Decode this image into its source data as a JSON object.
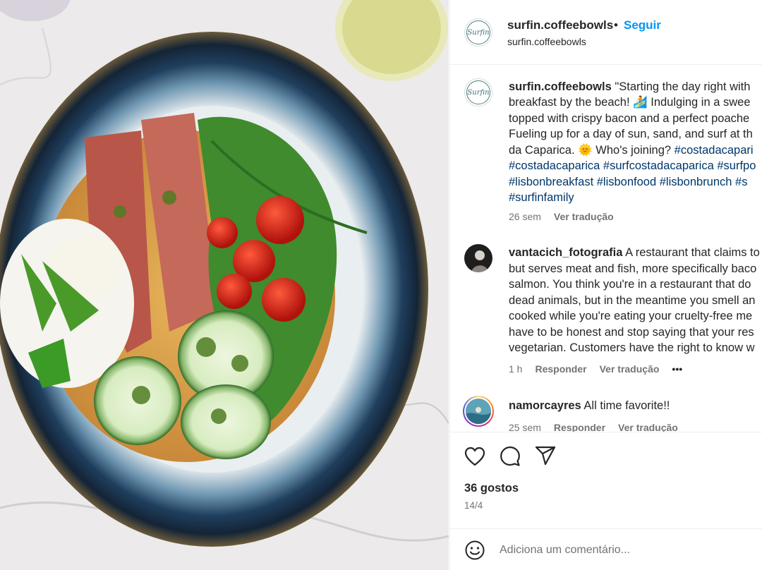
{
  "post": {
    "username": "surfin.coffeebowls",
    "follow_label": "Seguir",
    "location": "surfin.coffeebowls",
    "dot": "•",
    "avatar_text": "Surfin",
    "photo_alt": "Waffle with bacon, poached egg, cherry tomatoes, cucumber and arugula on a blue ceramic plate"
  },
  "caption": {
    "username": "surfin.coffeebowls",
    "lines": [
      "\"Starting the day right with",
      "breakfast by the beach! 🏄 Indulging in a swee",
      "topped with crispy bacon and a perfect poache",
      "Fueling up for a day of sun, sand, and surf at th",
      "da Caparica. 🌞 Who's joining?"
    ],
    "tag_inline": "#costadacapari",
    "tag_lines": [
      "#costadacaparica #surfcostadacaparica #surfpo",
      "#lisbonbreakfast #lisbonfood #lisbonbrunch #s",
      "#surfinfamily"
    ],
    "time": "26 sem",
    "translate": "Ver tradução"
  },
  "comments": [
    {
      "username": "vantacich_fotografia",
      "lines": [
        "A restaurant that claims to",
        "but serves meat and fish, more specifically baco",
        "salmon. You think you're in a restaurant that do",
        "dead animals, but in the meantime you smell an",
        "cooked while you're eating your cruelty-free me",
        "have to be honest and stop saying that your res",
        "vegetarian. Customers have the right to know w"
      ],
      "time": "1 h",
      "reply": "Responder",
      "translate": "Ver tradução",
      "more": "•••"
    },
    {
      "username": "namorcayres",
      "lines": [
        "All time favorite!!"
      ],
      "time": "25 sem",
      "reply": "Responder",
      "translate": "Ver tradução"
    }
  ],
  "actions": {
    "likes": "36 gostos",
    "date": "14/4",
    "comment_placeholder": "Adiciona um comentário..."
  },
  "icons": [
    "heart-icon",
    "comment-icon",
    "share-icon",
    "emoji-icon"
  ],
  "colors": {
    "link": "#0095f6",
    "hashtag": "#00376b",
    "muted": "#737373",
    "text": "#262626"
  }
}
